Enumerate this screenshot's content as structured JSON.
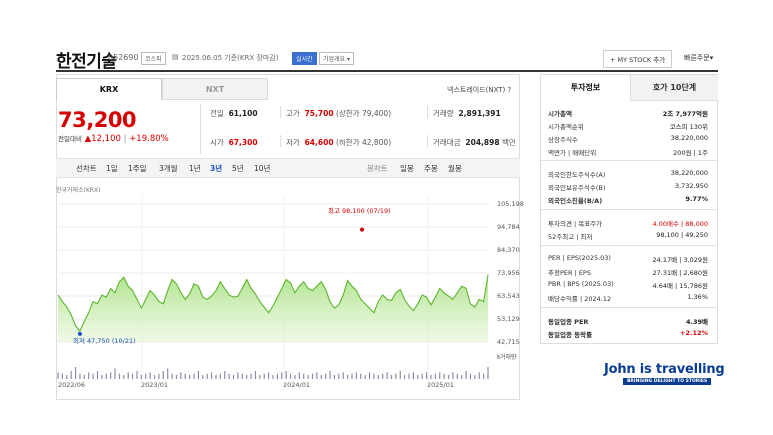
{
  "header": {
    "stock_name": "한전기술",
    "stock_code": "052690",
    "market_tag": "코스피",
    "date_text": "2025.06.05  기준(KRX 장마감)",
    "realtime_tag": "실시간",
    "overview_tag": "기업개요",
    "my_stock_btn": "+ MY STOCK 추가",
    "quick_order": "빠른주문"
  },
  "exchange_tabs": [
    "KRX",
    "NXT"
  ],
  "nextrade_label": "넥스트레이드(NXT)",
  "price": {
    "current": "73,200",
    "change_label": "전일대비",
    "change_value": "▲12,100",
    "change_pct": "+19.80%"
  },
  "quote_stats": {
    "prev_label": "전일",
    "prev_value": "61,100",
    "high_label": "고가",
    "high_value": "75,700",
    "upper_limit": "(상한가 79,400)",
    "volume_label": "거래량",
    "volume_value": "2,891,391",
    "open_label": "시가",
    "open_value": "67,300",
    "low_label": "저가",
    "low_value": "64,600",
    "lower_limit": "(하한가 42,800)",
    "amount_label": "거래대금",
    "amount_value": "204,898",
    "amount_unit": "백만"
  },
  "chart_toolbar": {
    "line_chart": "선차트",
    "periods": [
      "1일",
      "1주일",
      "3개월",
      "1년",
      "3년",
      "5년",
      "10년"
    ],
    "selected_period": "3년",
    "candle_chart": "봉차트",
    "candle_periods": [
      "일봉",
      "주봉",
      "월봉"
    ]
  },
  "chart_source": "한국거래소(KRX)",
  "chart_data": {
    "type": "area",
    "y_ticks": [
      "105,198",
      "94,784",
      "84,370",
      "73,956",
      "63,543",
      "53,129",
      "42,715"
    ],
    "ylim": [
      42715,
      105198
    ],
    "x_ticks": [
      "2022/06",
      "2023/01",
      "2024/01",
      "2025/01"
    ],
    "high_annotation": "최고 98,100 (07/19)",
    "low_annotation": "최저 47,750 (10/21)",
    "volume_label": "거래량",
    "series": [
      {
        "values": [
          64000,
          61000,
          58500,
          55000,
          50000,
          47750,
          52000,
          56000,
          61000,
          60000,
          64000,
          63000,
          67000,
          65000,
          70000,
          72000,
          68000,
          66000,
          62000,
          58000,
          62000,
          66000,
          64000,
          61000,
          60000,
          66000,
          71000,
          69000,
          65000,
          62000,
          64500,
          69000,
          68000,
          63000,
          62000,
          63500,
          66000,
          70000,
          67000,
          64000,
          63000,
          63500,
          67000,
          71000,
          67000,
          64500,
          61000,
          58500,
          56000,
          59000,
          63000,
          67000,
          71000,
          69500,
          65000,
          68000,
          70000,
          67000,
          66000,
          68000,
          70000,
          66500,
          61000,
          58000,
          59500,
          64000,
          70500,
          68000,
          66000,
          62000,
          60000,
          58000,
          56000,
          61000,
          64000,
          62000,
          61500,
          65000,
          66500,
          62000,
          59000,
          57000,
          60000,
          64000,
          63000,
          59500,
          63000,
          67000,
          65000,
          63500,
          62000,
          65000,
          68000,
          67000,
          60000,
          58500,
          62000,
          61000,
          73200
        ]
      }
    ],
    "volume": [
      5,
      4,
      3,
      6,
      9,
      4,
      3,
      5,
      4,
      6,
      3,
      4,
      5,
      8,
      4,
      3,
      5,
      4,
      6,
      3,
      4,
      5,
      3,
      4,
      6,
      8,
      4,
      3,
      5,
      4,
      3,
      4,
      6,
      3,
      4,
      5,
      3,
      4,
      6,
      4,
      3,
      5,
      4,
      3,
      4,
      6,
      3,
      4,
      5,
      3,
      4,
      5,
      6,
      4,
      3,
      5,
      4,
      3,
      4,
      5,
      3,
      4,
      6,
      3,
      4,
      5,
      3,
      4,
      5,
      4,
      3,
      5,
      4,
      3,
      4,
      5,
      3,
      4,
      6,
      3,
      4,
      5,
      3,
      4,
      5,
      3,
      4,
      5,
      4,
      3,
      5,
      4,
      3,
      6,
      4,
      3,
      5,
      4,
      9
    ]
  },
  "right_panel": {
    "tabs": [
      "투자정보",
      "호가 10단계"
    ],
    "rows": [
      {
        "k": "시가총액",
        "v": "2조 7,977억원",
        "bold": true
      },
      {
        "k": "시가총액순위",
        "v": "코스피 130위"
      },
      {
        "k": "상장주식수",
        "v": "38,220,000"
      },
      {
        "k": "액면가 | 매매단위",
        "v": "200원 | 1주"
      },
      {
        "k": "외국인한도주식수(A)",
        "v": "38,220,000"
      },
      {
        "k": "외국인보유주식수(B)",
        "v": "3,732,950"
      },
      {
        "k": "외국인소진율(B/A)",
        "v": "9.77%",
        "bold": true
      },
      {
        "k": "투자의견 | 목표주가",
        "v": "4.00매수 | 88,000",
        "red": true
      },
      {
        "k": "52주최고 | 최저",
        "v": "98,100 | 49,250"
      },
      {
        "k": "PER | EPS(2025.03)",
        "v": "24.17배 | 3,029원"
      },
      {
        "k": "추정PER | EPS",
        "v": "27.31배 | 2,680원"
      },
      {
        "k": "PBR | BPS (2025.03)",
        "v": "4.64배 | 15,786원"
      },
      {
        "k": "배당수익률 | 2024.12",
        "v": "1.36%"
      },
      {
        "k": "동일업종 PER",
        "v": "4.39배",
        "bold": true
      },
      {
        "k": "동일업종 등락률",
        "v": "+2.12%",
        "bold": true,
        "red": true
      }
    ]
  },
  "watermark": {
    "main": "John is travelling",
    "sub": "BRINGING DELIGHT TO STORIES"
  }
}
